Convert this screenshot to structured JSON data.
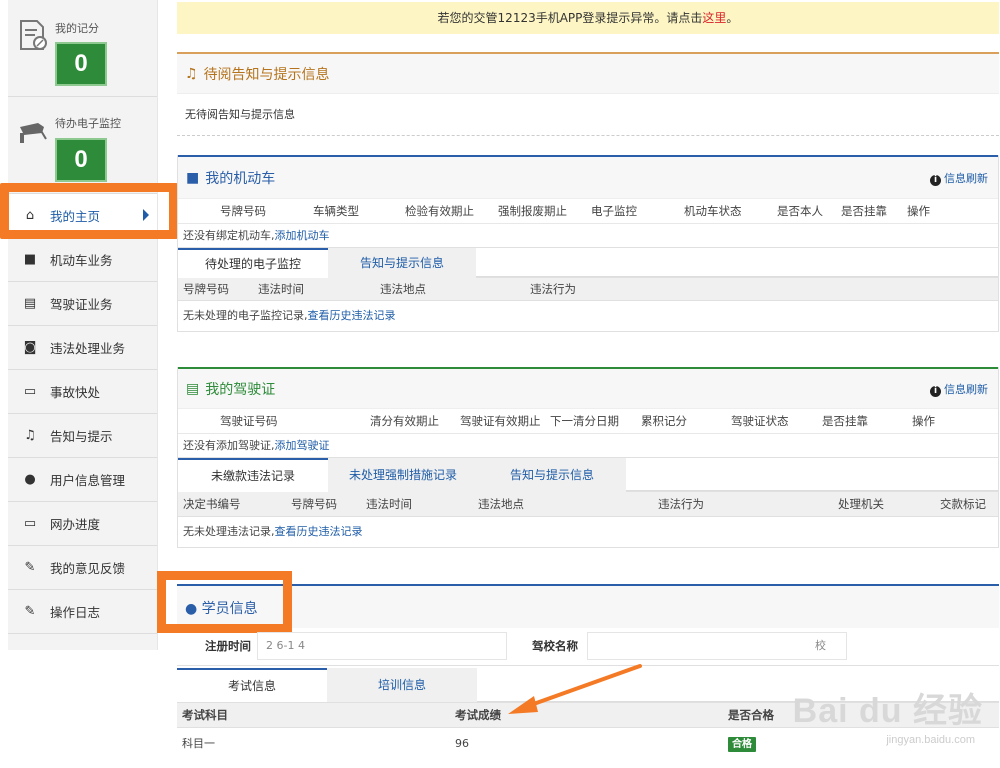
{
  "banner": {
    "text": "若您的交管12123手机APP登录提示异常。请点击",
    "link": "这里",
    "end": "。"
  },
  "sidebar": {
    "score_label": "我的记分",
    "score_value": "0",
    "monitor_label": "待办电子监控",
    "monitor_value": "0",
    "items": [
      {
        "label": "我的主页",
        "icon": "home-icon"
      },
      {
        "label": "机动车业务",
        "icon": "truck-icon"
      },
      {
        "label": "驾驶证业务",
        "icon": "card-icon"
      },
      {
        "label": "违法处理业务",
        "icon": "camera-icon"
      },
      {
        "label": "事故快处",
        "icon": "car-icon"
      },
      {
        "label": "告知与提示",
        "icon": "bell-icon"
      },
      {
        "label": "用户信息管理",
        "icon": "user-icon"
      },
      {
        "label": "网办进度",
        "icon": "progress-icon"
      },
      {
        "label": "我的意见反馈",
        "icon": "feedback-icon"
      },
      {
        "label": "操作日志",
        "icon": "log-icon"
      }
    ]
  },
  "notices": {
    "title": "待阅告知与提示信息",
    "empty": "无待阅告知与提示信息"
  },
  "vehicles": {
    "title": "我的机动车",
    "refresh": "信息刷新",
    "columns": [
      "号牌号码",
      "车辆类型",
      "检验有效期止",
      "强制报废期止",
      "电子监控",
      "机动车状态",
      "是否本人",
      "是否挂靠",
      "操作"
    ],
    "empty": "还没有绑定机动车,",
    "add_link": "添加机动车",
    "tabs": [
      "待处理的电子监控",
      "告知与提示信息"
    ],
    "sub_columns": [
      "号牌号码",
      "违法时间",
      "违法地点",
      "违法行为"
    ],
    "sub_empty": "无未处理的电子监控记录,",
    "sub_link": "查看历史违法记录"
  },
  "license": {
    "title": "我的驾驶证",
    "refresh": "信息刷新",
    "columns": [
      "驾驶证号码",
      "清分有效期止",
      "驾驶证有效期止",
      "下一清分日期",
      "累积记分",
      "驾驶证状态",
      "是否挂靠",
      "操作"
    ],
    "empty": "还没有添加驾驶证,",
    "add_link": "添加驾驶证",
    "tabs": [
      "未缴款违法记录",
      "未处理强制措施记录",
      "告知与提示信息"
    ],
    "sub_columns": [
      "决定书编号",
      "号牌号码",
      "违法时间",
      "违法地点",
      "违法行为",
      "处理机关",
      "交款标记"
    ],
    "sub_empty": "无未处理违法记录,",
    "sub_link": "查看历史违法记录"
  },
  "student": {
    "title": "学员信息",
    "reg_label": "注册时间",
    "reg_value": "2 6-1 4",
    "school_label": "驾校名称",
    "school_value": "校",
    "tabs": [
      "考试信息",
      "培训信息"
    ],
    "columns": [
      "考试科目",
      "考试成绩",
      "是否合格"
    ],
    "rows": [
      {
        "subject": "科目一",
        "score": "96",
        "pass": "合格"
      }
    ]
  },
  "watermark": {
    "brand": "Bai du 经验",
    "url": "jingyan.baidu.com"
  },
  "colors": {
    "accent": "#f47a25",
    "blue": "#2a5ea8",
    "green": "#2e8b3a"
  }
}
